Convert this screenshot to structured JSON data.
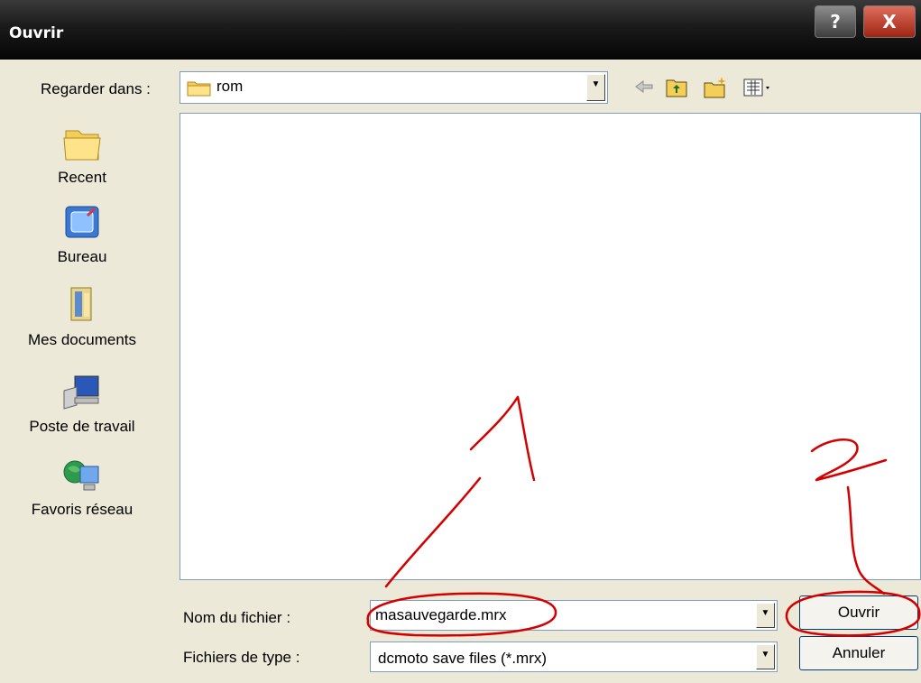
{
  "window": {
    "title": "Ouvrir",
    "help_label": "?",
    "close_label": "X"
  },
  "lookin": {
    "label": "Regarder dans :",
    "value": "rom"
  },
  "toolbar": {
    "back": "back-arrow-icon",
    "up": "up-folder-icon",
    "new_folder": "new-folder-icon",
    "views": "views-menu-icon"
  },
  "places": [
    {
      "label": "Recent",
      "icon": "recent-folder-icon"
    },
    {
      "label": "Bureau",
      "icon": "desktop-icon"
    },
    {
      "label": "Mes documents",
      "icon": "my-documents-icon"
    },
    {
      "label": "Poste de travail",
      "icon": "my-computer-icon"
    },
    {
      "label": "Favoris réseau",
      "icon": "network-places-icon"
    }
  ],
  "filename": {
    "label": "Nom du fichier :",
    "value": "masauvegarde.mrx"
  },
  "filetype": {
    "label": "Fichiers de type :",
    "value": "dcmoto save files (*.mrx)"
  },
  "buttons": {
    "open": "Ouvrir",
    "cancel": "Annuler"
  },
  "annotations": {
    "step1": "1",
    "step2": "2",
    "color": "#d40000"
  }
}
